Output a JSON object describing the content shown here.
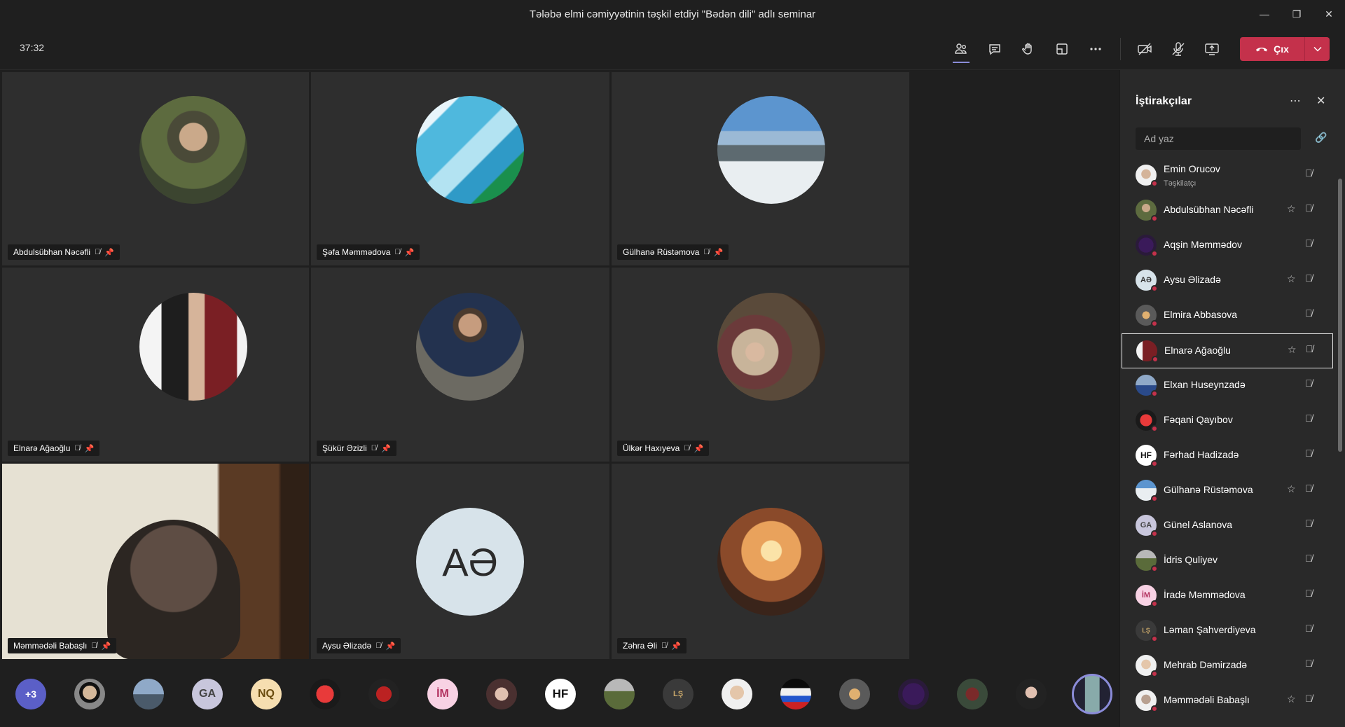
{
  "window": {
    "title": "Tələbə elmi cəmiyyətinin təşkil etdiyi \"Bədən dili\" adlı seminar"
  },
  "toolbar": {
    "timer": "37:32",
    "leave_label": "Çıx",
    "icons": [
      "participants-icon",
      "chat-icon",
      "raise-hand-icon",
      "breakout-rooms-icon",
      "more-options-icon",
      "camera-off-icon",
      "mic-off-icon",
      "share-screen-icon"
    ]
  },
  "colors": {
    "background": "#1f1f1f",
    "tile": "#2e2e2e",
    "panel": "#292929",
    "leave": "#c4314b",
    "accent": "#8b8cd9",
    "status_busy": "#c4314b"
  },
  "tiles": [
    {
      "name": "Abdulsübhan Nəcəfli"
    },
    {
      "name": "Şəfa Məmmədova"
    },
    {
      "name": "Gülhanə Rüstəmova"
    },
    {
      "name": "Elnarə Ağaoğlu"
    },
    {
      "name": "Şükür Əzizli"
    },
    {
      "name": "Ülkər Haxıyeva"
    },
    {
      "name": "Məmmədəli Babaşlı"
    },
    {
      "name": "Aysu Əlizadə",
      "initials": "AƏ"
    },
    {
      "name": "Zəhra Əli"
    }
  ],
  "strip": {
    "overflow": "+3",
    "chips": [
      "GA",
      "NQ",
      "İM",
      "HF",
      "LŞ"
    ]
  },
  "panel": {
    "title": "İştirakçılar",
    "search_placeholder": "Ad yaz",
    "participants": [
      {
        "name": "Emin Orucov",
        "role": "Təşkilatçı"
      },
      {
        "name": "Abdulsübhan Nəcəfli"
      },
      {
        "name": "Aqşin Məmmədov"
      },
      {
        "name": "Aysu Əlizadə",
        "initials": "AƏ"
      },
      {
        "name": "Elmira Abbasova"
      },
      {
        "name": "Elnarə Ağaoğlu"
      },
      {
        "name": "Elxan Huseynzadə"
      },
      {
        "name": "Fəqani Qayıbov"
      },
      {
        "name": "Fərhad Hadizadə",
        "initials": "HF"
      },
      {
        "name": "Gülhanə Rüstəmova"
      },
      {
        "name": "Günel Aslanova",
        "initials": "GA"
      },
      {
        "name": "İdris Quliyev"
      },
      {
        "name": "İradə Məmmədova",
        "initials": "İM"
      },
      {
        "name": "Ləman Şahverdiyeva",
        "initials": "LŞ"
      },
      {
        "name": "Mehrab Dəmirzadə"
      },
      {
        "name": "Məmmədəli Babaşlı"
      }
    ]
  }
}
